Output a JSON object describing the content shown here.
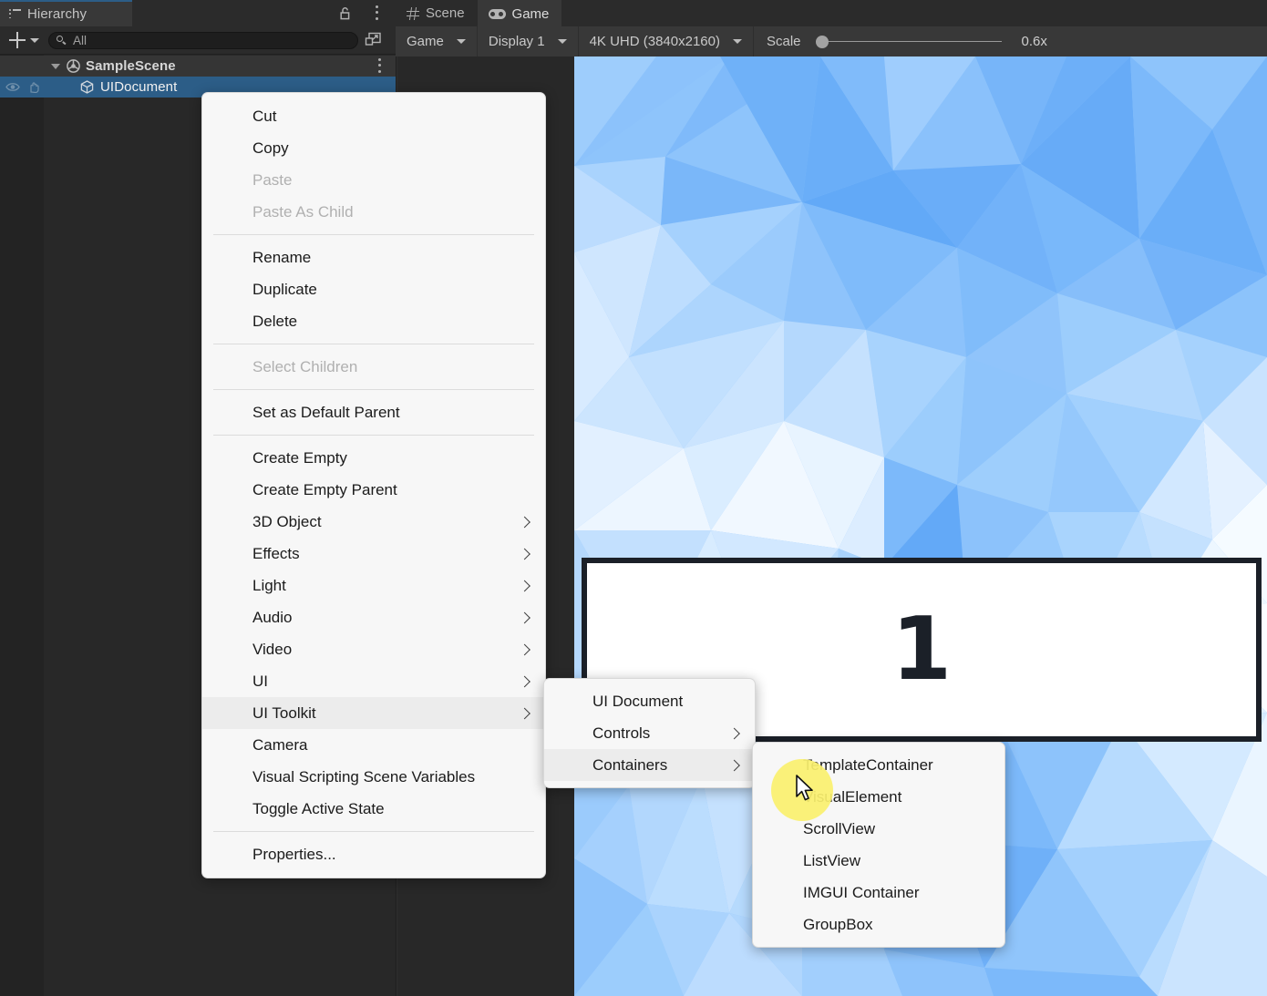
{
  "hierarchy": {
    "tab_label": "Hierarchy",
    "tab_icon": "list-icon",
    "lock_icon": "lock-open-icon",
    "kebab_icon": "kebab-menu-icon",
    "add_button_label": "+",
    "search_placeholder": "All",
    "search_value": "All",
    "search_icon": "search-icon",
    "expand_icon": "expand-search-icon",
    "rows": [
      {
        "label": "SampleScene",
        "icon": "unity-prefab-icon",
        "indent": 0,
        "selected": false,
        "has_foldout": true
      },
      {
        "label": "UIDocument",
        "icon": "cube-icon",
        "indent": 1,
        "selected": true,
        "has_foldout": false
      }
    ]
  },
  "game_view": {
    "tabs": [
      {
        "label": "Scene",
        "icon": "hash-grid-icon",
        "active": false
      },
      {
        "label": "Game",
        "icon": "gamepad-icon",
        "active": true
      }
    ],
    "toolbar": {
      "play_mode": "Game",
      "display": "Display 1",
      "resolution": "4K UHD (3840x2160)",
      "scale_label": "Scale",
      "scale_value": "0.6x",
      "scale_percent": 3
    },
    "ui_panel": {
      "number": "1"
    },
    "background": {
      "base": "#8ec4fb",
      "light": "#eaf4ff",
      "mid": "#b9daff",
      "dark": "#5aa8f5"
    }
  },
  "context_menu": {
    "items": [
      {
        "label": "Cut",
        "type": "item"
      },
      {
        "label": "Copy",
        "type": "item"
      },
      {
        "label": "Paste",
        "type": "item",
        "disabled": true
      },
      {
        "label": "Paste As Child",
        "type": "item",
        "disabled": true
      },
      {
        "label": "",
        "type": "separator"
      },
      {
        "label": "Rename",
        "type": "item"
      },
      {
        "label": "Duplicate",
        "type": "item"
      },
      {
        "label": "Delete",
        "type": "item"
      },
      {
        "label": "",
        "type": "separator"
      },
      {
        "label": "Select Children",
        "type": "item",
        "disabled": true
      },
      {
        "label": "",
        "type": "separator"
      },
      {
        "label": "Set as Default Parent",
        "type": "item"
      },
      {
        "label": "",
        "type": "separator"
      },
      {
        "label": "Create Empty",
        "type": "item"
      },
      {
        "label": "Create Empty Parent",
        "type": "item"
      },
      {
        "label": "3D Object",
        "type": "item",
        "submenu": true
      },
      {
        "label": "Effects",
        "type": "item",
        "submenu": true
      },
      {
        "label": "Light",
        "type": "item",
        "submenu": true
      },
      {
        "label": "Audio",
        "type": "item",
        "submenu": true
      },
      {
        "label": "Video",
        "type": "item",
        "submenu": true
      },
      {
        "label": "UI",
        "type": "item",
        "submenu": true
      },
      {
        "label": "UI Toolkit",
        "type": "item",
        "submenu": true,
        "highlight": true
      },
      {
        "label": "Camera",
        "type": "item"
      },
      {
        "label": "Visual Scripting Scene Variables",
        "type": "item"
      },
      {
        "label": "Toggle Active State",
        "type": "item"
      },
      {
        "label": "",
        "type": "separator"
      },
      {
        "label": "Properties...",
        "type": "item"
      }
    ]
  },
  "submenu_uitoolkit": {
    "items": [
      {
        "label": "UI Document",
        "submenu": false
      },
      {
        "label": "Controls",
        "submenu": true
      },
      {
        "label": "Containers",
        "submenu": true,
        "highlight": true
      }
    ]
  },
  "submenu_containers": {
    "items": [
      {
        "label": "TemplateContainer"
      },
      {
        "label": "VisualElement"
      },
      {
        "label": "ScrollView"
      },
      {
        "label": "ListView"
      },
      {
        "label": "IMGUI Container"
      },
      {
        "label": "GroupBox"
      }
    ]
  },
  "cursor": {
    "icon": "mouse-pointer-icon",
    "click_highlight_color": "#faf06e"
  }
}
